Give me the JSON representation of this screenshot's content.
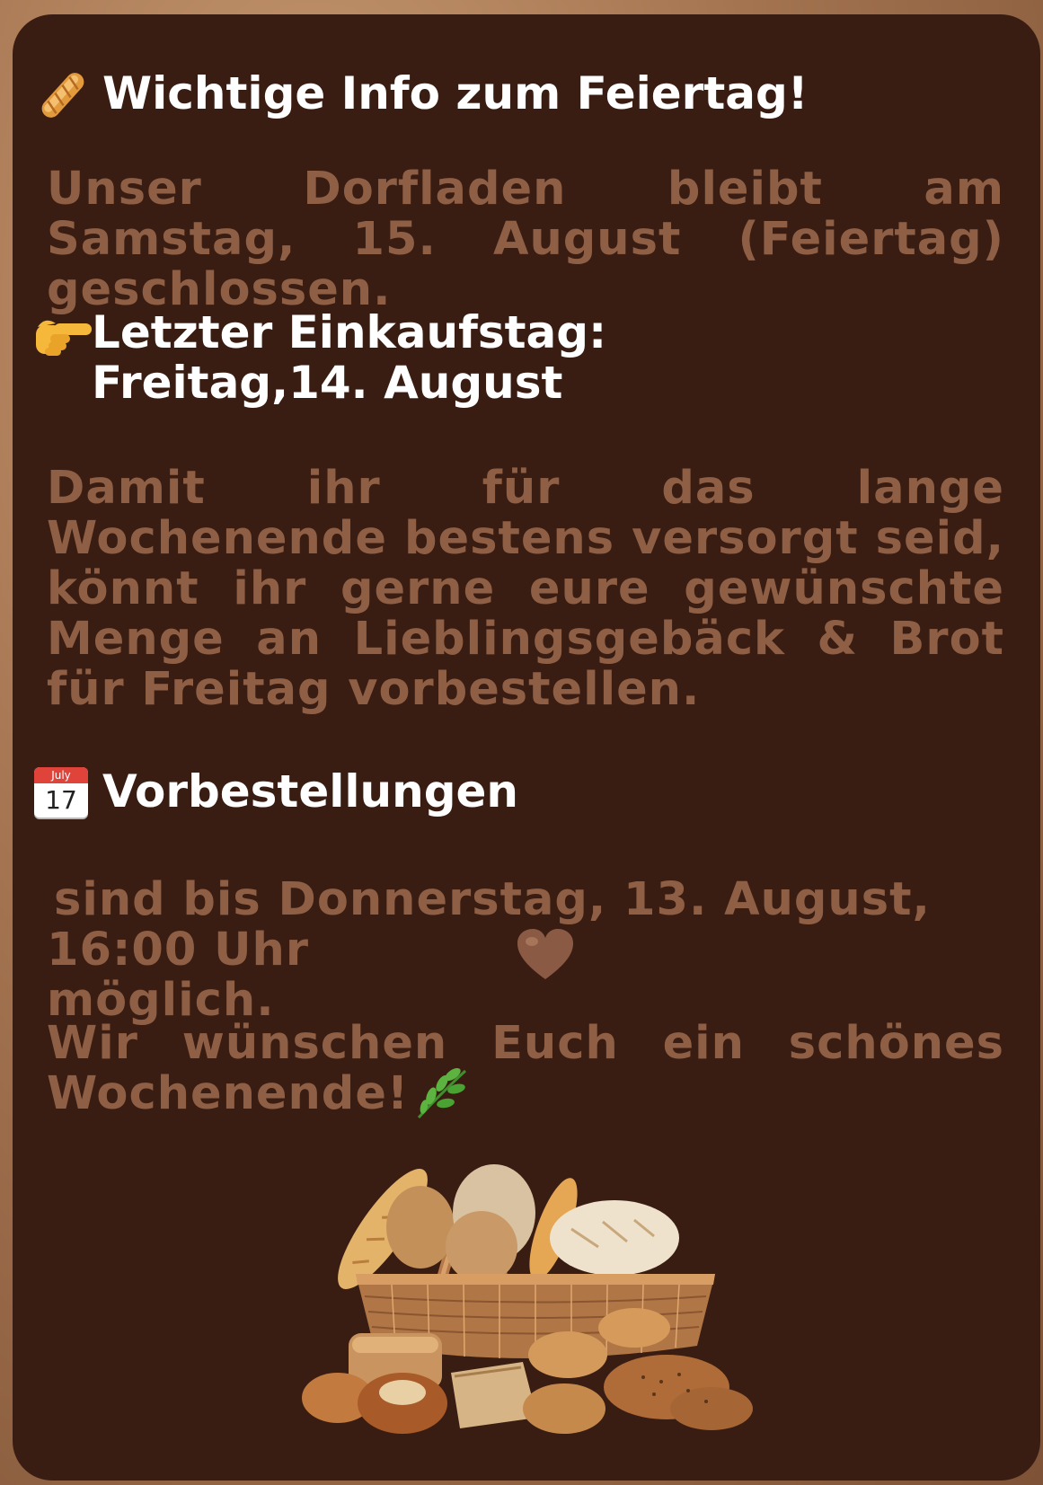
{
  "notice": {
    "title": "Wichtige Info zum Feiertag!",
    "closure": "Unser Dorfladen bleibt am Samstag, 15. August (Feiertag) geschlossen.",
    "last_day_label": "Letzter Einkaufstag:",
    "last_day_value": "Freitag,14. August",
    "preorder_info": "Damit ihr für das lange Wochenende bestens versorgt seid, könnt ihr gerne eure gewünschte Menge an Lieblingsgebäck & Brot für Freitag vorbestellen.",
    "preorder_heading": "Vorbestellungen",
    "calendar_month": "July",
    "calendar_day": "17",
    "deadline_line1": "sind bis Donnerstag, 13. August,",
    "deadline_line2": "16:00 Uhr möglich.",
    "closing": "Wir wünschen Euch ein schönes Wochenende!"
  },
  "icons": [
    "baguette-icon",
    "pointing-hand-icon",
    "calendar-icon",
    "brown-heart-icon",
    "herb-icon",
    "bread-basket-image"
  ],
  "colors": {
    "background": "#3a1d12",
    "heading_text": "#ffffff",
    "body_text": "#8f5f45"
  }
}
